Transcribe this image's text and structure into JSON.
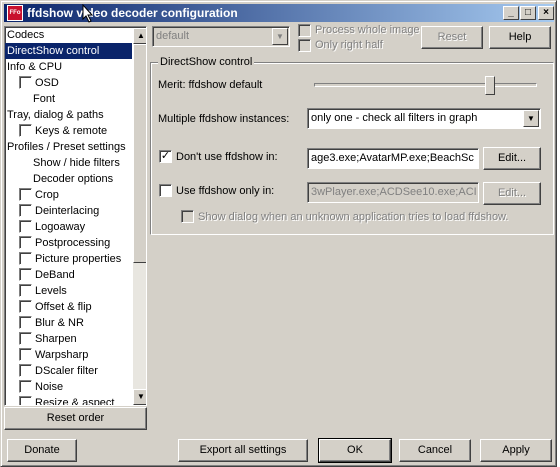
{
  "window": {
    "title": "ffdshow video decoder configuration",
    "icon_text": "FFo",
    "minimize": "_",
    "maximize": "□",
    "close": "×"
  },
  "toolbar": {
    "preset_value": "default",
    "process_whole_image": "Process whole image",
    "only_right_half": "Only right half",
    "reset_label": "Reset",
    "help_label": "Help"
  },
  "sidebar": {
    "items": [
      {
        "label": "Codecs",
        "indent": 0,
        "checkbox": false,
        "selected": false
      },
      {
        "label": "DirectShow control",
        "indent": 0,
        "checkbox": false,
        "selected": true
      },
      {
        "label": "Info & CPU",
        "indent": 0,
        "checkbox": false,
        "selected": false
      },
      {
        "label": "OSD",
        "indent": 1,
        "checkbox": true,
        "checked": false,
        "selected": false
      },
      {
        "label": "Font",
        "indent": 2,
        "checkbox": false,
        "selected": false
      },
      {
        "label": "Tray, dialog & paths",
        "indent": 0,
        "checkbox": false,
        "selected": false
      },
      {
        "label": "Keys & remote",
        "indent": 1,
        "checkbox": true,
        "checked": false,
        "selected": false
      },
      {
        "label": "Profiles / Preset settings",
        "indent": 0,
        "checkbox": false,
        "selected": false
      },
      {
        "label": "Show / hide filters",
        "indent": 2,
        "checkbox": false,
        "selected": false
      },
      {
        "label": "Decoder options",
        "indent": 2,
        "checkbox": false,
        "selected": false
      },
      {
        "label": "Crop",
        "indent": 1,
        "checkbox": true,
        "checked": false,
        "selected": false
      },
      {
        "label": "Deinterlacing",
        "indent": 1,
        "checkbox": true,
        "checked": false,
        "selected": false
      },
      {
        "label": "Logoaway",
        "indent": 1,
        "checkbox": true,
        "checked": false,
        "selected": false
      },
      {
        "label": "Postprocessing",
        "indent": 1,
        "checkbox": true,
        "checked": false,
        "selected": false
      },
      {
        "label": "Picture properties",
        "indent": 1,
        "checkbox": true,
        "checked": false,
        "selected": false
      },
      {
        "label": "DeBand",
        "indent": 1,
        "checkbox": true,
        "checked": false,
        "selected": false
      },
      {
        "label": "Levels",
        "indent": 1,
        "checkbox": true,
        "checked": false,
        "selected": false
      },
      {
        "label": "Offset & flip",
        "indent": 1,
        "checkbox": true,
        "checked": false,
        "selected": false
      },
      {
        "label": "Blur & NR",
        "indent": 1,
        "checkbox": true,
        "checked": false,
        "selected": false
      },
      {
        "label": "Sharpen",
        "indent": 1,
        "checkbox": true,
        "checked": false,
        "selected": false
      },
      {
        "label": "Warpsharp",
        "indent": 1,
        "checkbox": true,
        "checked": false,
        "selected": false
      },
      {
        "label": "DScaler filter",
        "indent": 1,
        "checkbox": true,
        "checked": false,
        "selected": false
      },
      {
        "label": "Noise",
        "indent": 1,
        "checkbox": true,
        "checked": false,
        "selected": false
      },
      {
        "label": "Resize & aspect",
        "indent": 1,
        "checkbox": true,
        "checked": false,
        "selected": false
      }
    ],
    "reset_order_label": "Reset order"
  },
  "panel": {
    "group_title": "DirectShow control",
    "merit_label": "Merit: ffdshow default",
    "merit_level": 0.79,
    "multiple_label": "Multiple ffdshow instances:",
    "multiple_value": "only one - check all filters in graph",
    "dont_use_label": "Don't use ffdshow in:",
    "dont_use_checked": true,
    "dont_use_value": "age3.exe;AvatarMP.exe;BeachSc",
    "edit1_label": "Edit...",
    "use_only_label": "Use ffdshow only in:",
    "use_only_checked": false,
    "use_only_value": "3wPlayer.exe;ACDSee10.exe;ACI",
    "edit2_label": "Edit...",
    "show_dialog_label": "Show dialog when an unknown application tries to load ffdshow."
  },
  "footer": {
    "donate_label": "Donate",
    "export_label": "Export all settings",
    "ok_label": "OK",
    "cancel_label": "Cancel",
    "apply_label": "Apply"
  }
}
